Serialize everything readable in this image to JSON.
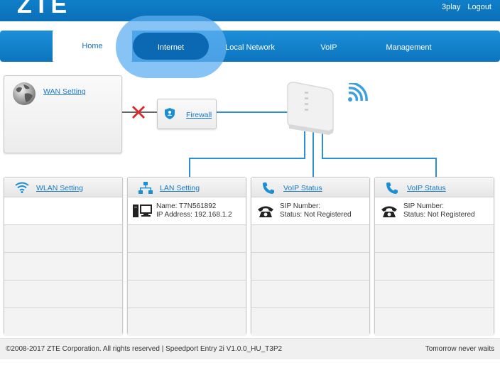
{
  "header": {
    "logo": "ZTE",
    "links": [
      "3play",
      "Logout"
    ]
  },
  "nav": {
    "items": [
      "Home",
      "Internet",
      "Local Network",
      "VoIP",
      "Management"
    ],
    "active": "Home",
    "highlighted": "Internet"
  },
  "wan": {
    "label": "WAN Setting",
    "status_icon": "red-x-icon"
  },
  "firewall": {
    "label": "Firewall"
  },
  "cards": [
    {
      "title": "WLAN Setting",
      "icon": "wifi-icon",
      "line1": "",
      "line2": ""
    },
    {
      "title": "LAN Setting",
      "icon": "network-icon",
      "line1": "Name: T7N561892",
      "line2": "IP Address: 192.168.1.2"
    },
    {
      "title": "VoIP Status",
      "icon": "phone-icon",
      "line1": "SIP Number:",
      "line2": "Status: Not Registered"
    },
    {
      "title": "VoIP Status",
      "icon": "phone-icon",
      "line1": "SIP Number:",
      "line2": "Status: Not Registered"
    }
  ],
  "footer": {
    "left": "©2008-2017 ZTE Corporation. All rights reserved  |   Speedport Entry 2i V1.0.0_HU_T3P2",
    "right": "Tomorrow never waits"
  },
  "colors": {
    "accent": "#0f7fc9",
    "link": "#1a79c9",
    "error": "#d62b2b",
    "wire": "#2b8fd2"
  }
}
